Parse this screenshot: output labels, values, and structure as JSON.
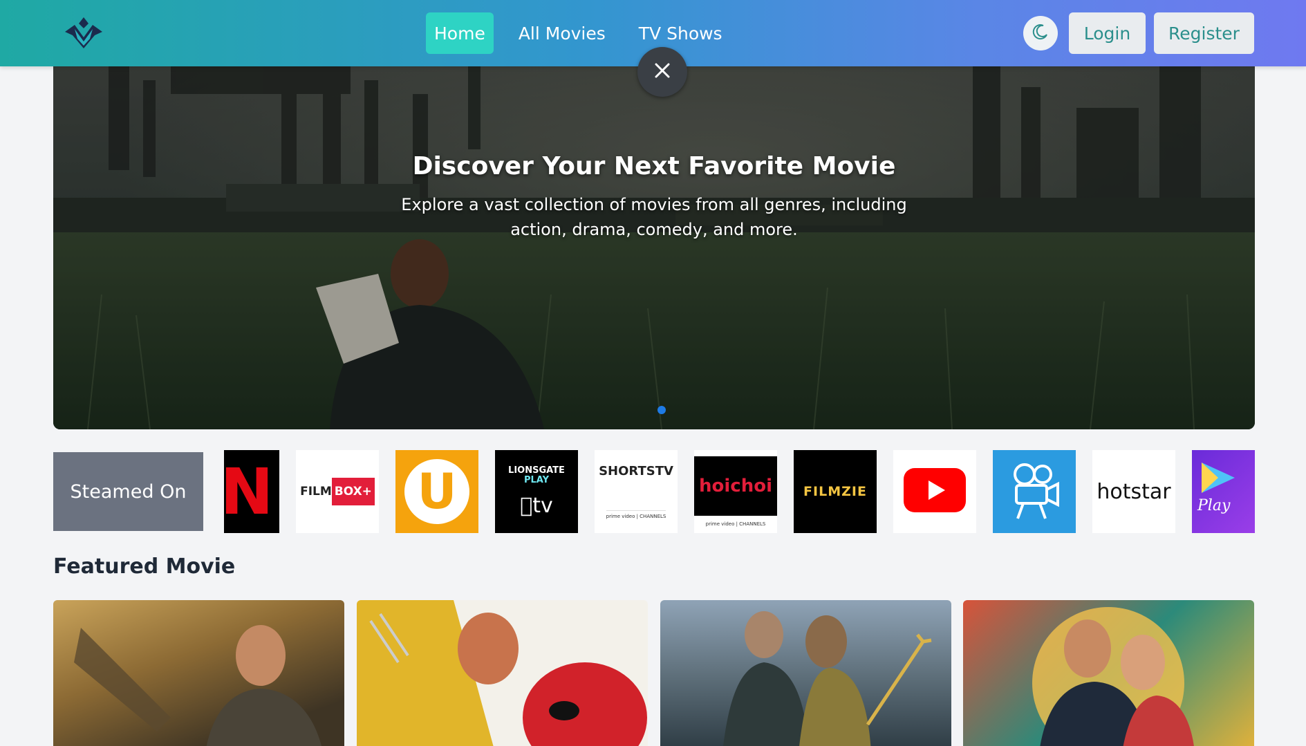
{
  "header": {
    "nav": [
      "Home",
      "All Movies",
      "TV Shows"
    ],
    "login_label": "Login",
    "register_label": "Register",
    "theme_icon": "moon-icon"
  },
  "hero": {
    "title": "Discover Your Next Favorite Movie",
    "subtitle": "Explore a vast collection of movies from all genres, including action, drama, comedy, and more."
  },
  "streamed": {
    "label": "Steamed On",
    "providers": [
      {
        "name": "N",
        "icon": "netflix-logo"
      },
      {
        "name": "FILMBOX+",
        "icon": "filmbox-logo"
      },
      {
        "name": "U",
        "icon": "u-logo"
      },
      {
        "name": "LIONSGATE PLAY",
        "icon": "lionsgate-appletv-logo",
        "sub": "tv"
      },
      {
        "name": "SHORTSTV",
        "icon": "shortstv-logo",
        "sub": "prime video | CHANNELS"
      },
      {
        "name": "hoichoi",
        "icon": "hoichoi-logo",
        "sub": "prime video | CHANNELS"
      },
      {
        "name": "FILMZIE",
        "icon": "filmzie-logo"
      },
      {
        "name": "YouTube",
        "icon": "youtube-logo"
      },
      {
        "name": "Projector",
        "icon": "projector-logo"
      },
      {
        "name": "hotstar",
        "icon": "hotstar-logo"
      },
      {
        "name": "Play",
        "icon": "play-logo"
      }
    ]
  },
  "featured": {
    "title": "Featured Movie"
  },
  "colors": {
    "accent": "#2ed3c4",
    "header_start": "#1fa9a4",
    "header_end": "#6f79f0",
    "label_bg": "#6b7280"
  }
}
